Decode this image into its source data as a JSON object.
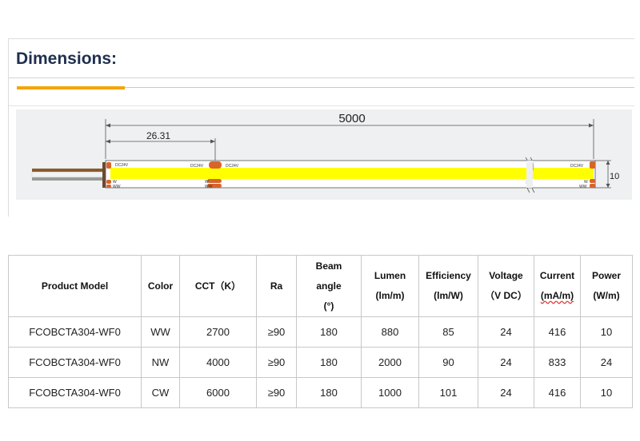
{
  "section": {
    "title": "Dimensions:"
  },
  "drawing": {
    "length_label": "5000",
    "pitch_label": "26.31",
    "width_label": "10",
    "pad_labels": {
      "dc_left": "DC24V",
      "dc_mid_left": "DC24V",
      "dc_mid_right": "DC24V",
      "dc_right": "DC24V",
      "w": "W",
      "ww": "WW"
    },
    "colors": {
      "strip": "#ffff00",
      "pad": "#d9642b",
      "wire_brown": "#8a5a2e",
      "wire_white": "#f2f2f2",
      "wire_grey": "#9a9a9a",
      "background": "#eef0f1"
    }
  },
  "table": {
    "headers": [
      [
        "Product Model"
      ],
      [
        "Color"
      ],
      [
        "CCT（K）"
      ],
      [
        "Ra"
      ],
      [
        "Beam",
        "angle",
        "(°)"
      ],
      [
        "Lumen",
        "(lm/m)"
      ],
      [
        "Efficiency",
        "(lm/W)"
      ],
      [
        "Voltage",
        "（V DC）"
      ],
      [
        "Current",
        "(mA/m)"
      ],
      [
        "Power",
        "(W/m)"
      ]
    ],
    "rows": [
      [
        "FCOBCTA304-WF0",
        "WW",
        "2700",
        "≥90",
        "180",
        "880",
        "85",
        "24",
        "416",
        "10"
      ],
      [
        "FCOBCTA304-WF0",
        "NW",
        "4000",
        "≥90",
        "180",
        "2000",
        "90",
        "24",
        "833",
        "24"
      ],
      [
        "FCOBCTA304-WF0",
        "CW",
        "6000",
        "≥90",
        "180",
        "1000",
        "101",
        "24",
        "416",
        "10"
      ]
    ]
  }
}
